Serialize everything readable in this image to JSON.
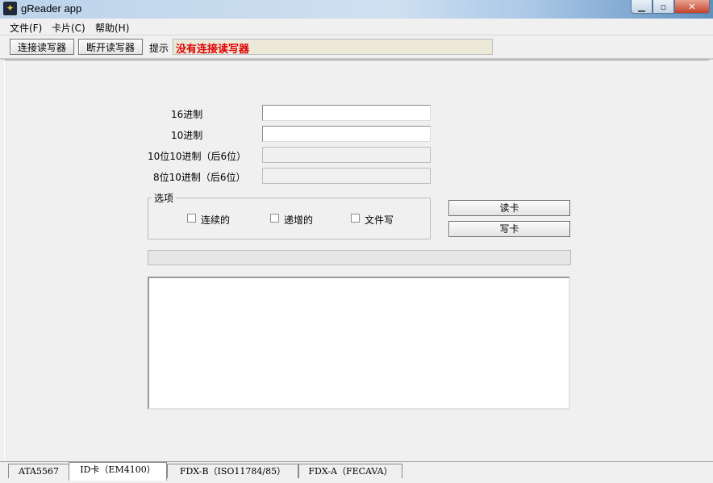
{
  "window": {
    "title": "gReader app"
  },
  "menu": [
    "文件(F)",
    "卡片(C)",
    "帮助(H)"
  ],
  "toolbar": {
    "connect_label": "连接读写器",
    "disconnect_label": "断开读写器",
    "hint_label": "提示",
    "hint_text": "没有连接读写器"
  },
  "form": {
    "hex_label": "16进制",
    "dec_label": "10进制",
    "dec10_last6_label": "10位10进制（后6位）",
    "dec8_last6_label": "8位10进制（后6位）",
    "hex_value": "",
    "dec_value": "",
    "dec10_last6_value": "",
    "dec8_last6_value": ""
  },
  "options": {
    "title": "选项",
    "continuous": "连续的",
    "increment": "递增的",
    "file_write": "文件写",
    "continuous_checked": false,
    "increment_checked": false,
    "file_write_checked": false
  },
  "actions": {
    "read_label": "读卡",
    "write_label": "写卡"
  },
  "progress": {
    "value": 0
  },
  "log": {
    "text": ""
  },
  "tabs": [
    {
      "label": "ATA5567",
      "active": false
    },
    {
      "label": "ID卡（EM4100）",
      "active": true
    },
    {
      "label": "FDX-B（ISO11784/85）",
      "active": false
    },
    {
      "label": "FDX-A（FECAVA）",
      "active": false
    }
  ]
}
